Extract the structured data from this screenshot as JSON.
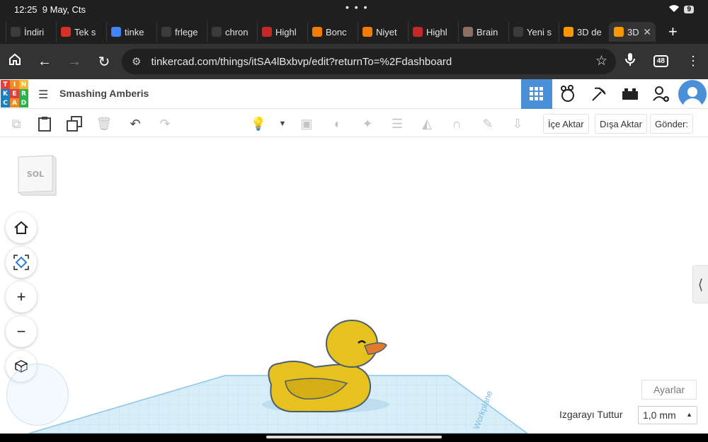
{
  "status": {
    "time": "12:25",
    "date": "9 May, Cts",
    "battery": "9"
  },
  "tabs": [
    {
      "label": "İndiri",
      "icon": "chrome-icon",
      "color": "#3b3b3b"
    },
    {
      "label": "Tek s",
      "icon": "gmail-icon",
      "color": "#d93025"
    },
    {
      "label": "tinke",
      "icon": "google-icon",
      "color": "#4285f4"
    },
    {
      "label": "frlege",
      "icon": "globe-icon",
      "color": "#3b3b3b"
    },
    {
      "label": "chron",
      "icon": "chrome-icon",
      "color": "#3b3b3b"
    },
    {
      "label": "Highl",
      "icon": "highlight-icon",
      "color": "#c62828"
    },
    {
      "label": "Bonc",
      "icon": "hb-icon",
      "color": "#f57c00"
    },
    {
      "label": "Niyet",
      "icon": "hb-icon",
      "color": "#f57c00"
    },
    {
      "label": "Highl",
      "icon": "highlight-icon",
      "color": "#c62828"
    },
    {
      "label": "Brain",
      "icon": "brain-icon",
      "color": "#8d6e63"
    },
    {
      "label": "Yeni s",
      "icon": "globe-icon",
      "color": "#3b3b3b"
    },
    {
      "label": "3D de",
      "icon": "tinkercad-icon",
      "color": "#ff9800"
    },
    {
      "label": "3D",
      "icon": "tinkercad-icon",
      "color": "#ff9800"
    }
  ],
  "url": "tinkercad.com/things/itSA4lBxbvp/edit?returnTo=%2Fdashboard",
  "tab_count": "48",
  "logo_letters": [
    "T",
    "I",
    "N",
    "K",
    "E",
    "R",
    "C",
    "A",
    "D"
  ],
  "logo_colors": [
    "#e2403d",
    "#f08a24",
    "#f7b731",
    "#1a80c4",
    "#e2403d",
    "#2db14b",
    "#1a80c4",
    "#f08a24",
    "#2db14b"
  ],
  "design_name": "Smashing Amberis",
  "toolbar": {
    "import": "İçe Aktar",
    "export": "Dışa Aktar",
    "send": "Gönder:"
  },
  "viewcube_label": "SOL",
  "settings": "Ayarlar",
  "snap_label": "Izgarayı Tuttur",
  "snap_value": "1,0 mm",
  "plane_text": "Workplane",
  "colors": {
    "accent": "#4a90d9",
    "duck": "#e7c21f",
    "beak": "#e07a2e",
    "grid": "#d7edf8"
  }
}
